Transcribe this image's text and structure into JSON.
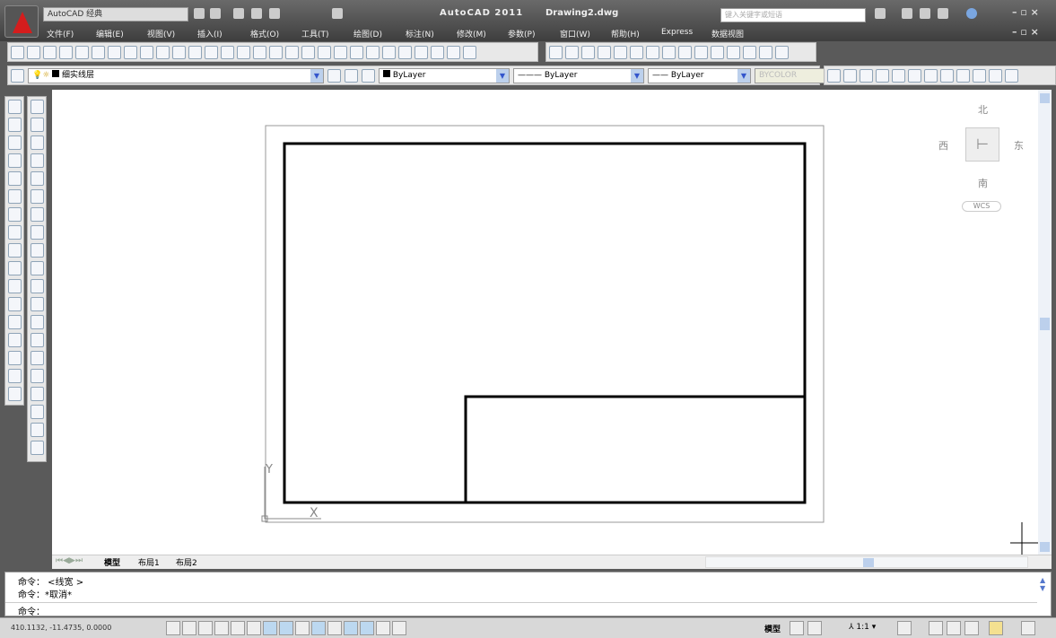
{
  "title_bar": {
    "app_title": "AutoCAD 2011",
    "document": "Drawing2.dwg",
    "workspace": "AutoCAD 经典",
    "search_placeholder": "键入关键字或短语"
  },
  "menu": [
    "文件(F)",
    "编辑(E)",
    "视图(V)",
    "插入(I)",
    "格式(O)",
    "工具(T)",
    "绘图(D)",
    "标注(N)",
    "修改(M)",
    "参数(P)",
    "窗口(W)",
    "帮助(H)",
    "Express",
    "数据视图"
  ],
  "properties": {
    "layer": "细实线层",
    "color": "ByLayer",
    "linetype": "ByLayer",
    "lineweight": "ByLayer",
    "plotstyle": "BYCOLOR"
  },
  "viewcube": {
    "north": "北",
    "south": "南",
    "east": "东",
    "west": "西",
    "wcs": "WCS"
  },
  "ucs": {
    "x": "X",
    "y": "Y"
  },
  "tabs": [
    "模型",
    "布局1",
    "布局2"
  ],
  "command": {
    "lines": [
      "命令： <线宽 >",
      "命令：*取消*"
    ],
    "prompt": "命令："
  },
  "status": {
    "coords": "410.1132, -11.4735, 0.0000",
    "model": "模型",
    "scale": "1:1"
  }
}
